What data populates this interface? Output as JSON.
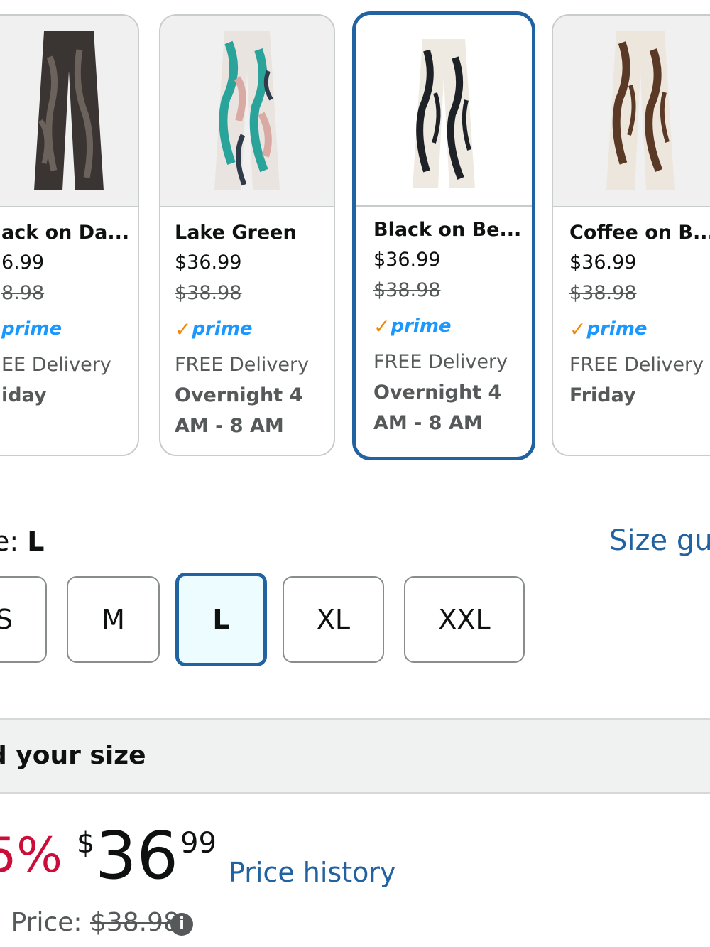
{
  "variants": [
    {
      "name": "ack on Da...",
      "price": "6.99",
      "list_price": "8.98",
      "prime": "prime",
      "delivery": "EE Delivery",
      "when": "iday"
    },
    {
      "name": "Lake Green",
      "price": "$36.99",
      "list_price": "$38.98",
      "prime": "prime",
      "delivery": "FREE Delivery",
      "when": "Overnight 4 AM - 8 AM"
    },
    {
      "name": "Black on Be...",
      "price": "$36.99",
      "list_price": "$38.98",
      "prime": "prime",
      "delivery": "FREE Delivery",
      "when": "Overnight 4 AM - 8 AM",
      "selected": true
    },
    {
      "name": "Coffee on B...",
      "price": "$36.99",
      "list_price": "$38.98",
      "prime": "prime",
      "delivery": "FREE Delivery",
      "when": "Friday"
    }
  ],
  "size": {
    "label": "e: ",
    "selected": "L",
    "guide_link": "Size gu",
    "options": [
      "S",
      "M",
      "L",
      "XL",
      "XXL"
    ]
  },
  "find_size": {
    "label": "d your size"
  },
  "pricing": {
    "discount": "5%",
    "currency": "$",
    "whole": "36",
    "fraction": "99",
    "history_link": "Price history",
    "list_label": ": Price: ",
    "list_value": "$38.98"
  },
  "colors": {
    "accent": "#2162a1",
    "discount": "#cc0c39",
    "prime_blue": "#1a98ff",
    "prime_check": "#f08804"
  }
}
